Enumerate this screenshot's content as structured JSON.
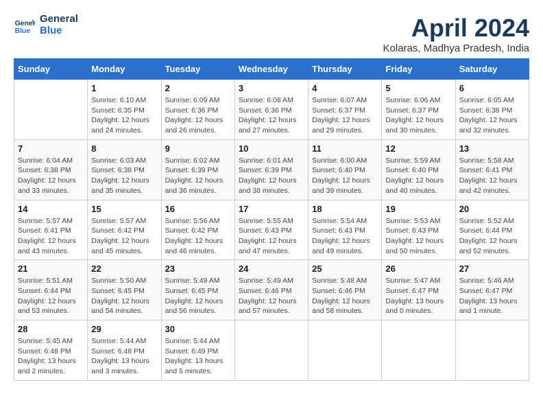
{
  "header": {
    "logo_line1": "General",
    "logo_line2": "Blue",
    "month_year": "April 2024",
    "location": "Kolaras, Madhya Pradesh, India"
  },
  "days_of_week": [
    "Sunday",
    "Monday",
    "Tuesday",
    "Wednesday",
    "Thursday",
    "Friday",
    "Saturday"
  ],
  "weeks": [
    [
      {
        "num": "",
        "info": ""
      },
      {
        "num": "1",
        "info": "Sunrise: 6:10 AM\nSunset: 6:35 PM\nDaylight: 12 hours\nand 24 minutes."
      },
      {
        "num": "2",
        "info": "Sunrise: 6:09 AM\nSunset: 6:36 PM\nDaylight: 12 hours\nand 26 minutes."
      },
      {
        "num": "3",
        "info": "Sunrise: 6:08 AM\nSunset: 6:36 PM\nDaylight: 12 hours\nand 27 minutes."
      },
      {
        "num": "4",
        "info": "Sunrise: 6:07 AM\nSunset: 6:37 PM\nDaylight: 12 hours\nand 29 minutes."
      },
      {
        "num": "5",
        "info": "Sunrise: 6:06 AM\nSunset: 6:37 PM\nDaylight: 12 hours\nand 30 minutes."
      },
      {
        "num": "6",
        "info": "Sunrise: 6:05 AM\nSunset: 6:38 PM\nDaylight: 12 hours\nand 32 minutes."
      }
    ],
    [
      {
        "num": "7",
        "info": "Sunrise: 6:04 AM\nSunset: 6:38 PM\nDaylight: 12 hours\nand 33 minutes."
      },
      {
        "num": "8",
        "info": "Sunrise: 6:03 AM\nSunset: 6:38 PM\nDaylight: 12 hours\nand 35 minutes."
      },
      {
        "num": "9",
        "info": "Sunrise: 6:02 AM\nSunset: 6:39 PM\nDaylight: 12 hours\nand 36 minutes."
      },
      {
        "num": "10",
        "info": "Sunrise: 6:01 AM\nSunset: 6:39 PM\nDaylight: 12 hours\nand 38 minutes."
      },
      {
        "num": "11",
        "info": "Sunrise: 6:00 AM\nSunset: 6:40 PM\nDaylight: 12 hours\nand 39 minutes."
      },
      {
        "num": "12",
        "info": "Sunrise: 5:59 AM\nSunset: 6:40 PM\nDaylight: 12 hours\nand 40 minutes."
      },
      {
        "num": "13",
        "info": "Sunrise: 5:58 AM\nSunset: 6:41 PM\nDaylight: 12 hours\nand 42 minutes."
      }
    ],
    [
      {
        "num": "14",
        "info": "Sunrise: 5:57 AM\nSunset: 6:41 PM\nDaylight: 12 hours\nand 43 minutes."
      },
      {
        "num": "15",
        "info": "Sunrise: 5:57 AM\nSunset: 6:42 PM\nDaylight: 12 hours\nand 45 minutes."
      },
      {
        "num": "16",
        "info": "Sunrise: 5:56 AM\nSunset: 6:42 PM\nDaylight: 12 hours\nand 46 minutes."
      },
      {
        "num": "17",
        "info": "Sunrise: 5:55 AM\nSunset: 6:43 PM\nDaylight: 12 hours\nand 47 minutes."
      },
      {
        "num": "18",
        "info": "Sunrise: 5:54 AM\nSunset: 6:43 PM\nDaylight: 12 hours\nand 49 minutes."
      },
      {
        "num": "19",
        "info": "Sunrise: 5:53 AM\nSunset: 6:43 PM\nDaylight: 12 hours\nand 50 minutes."
      },
      {
        "num": "20",
        "info": "Sunrise: 5:52 AM\nSunset: 6:44 PM\nDaylight: 12 hours\nand 52 minutes."
      }
    ],
    [
      {
        "num": "21",
        "info": "Sunrise: 5:51 AM\nSunset: 6:44 PM\nDaylight: 12 hours\nand 53 minutes."
      },
      {
        "num": "22",
        "info": "Sunrise: 5:50 AM\nSunset: 6:45 PM\nDaylight: 12 hours\nand 54 minutes."
      },
      {
        "num": "23",
        "info": "Sunrise: 5:49 AM\nSunset: 6:45 PM\nDaylight: 12 hours\nand 56 minutes."
      },
      {
        "num": "24",
        "info": "Sunrise: 5:49 AM\nSunset: 6:46 PM\nDaylight: 12 hours\nand 57 minutes."
      },
      {
        "num": "25",
        "info": "Sunrise: 5:48 AM\nSunset: 6:46 PM\nDaylight: 12 hours\nand 58 minutes."
      },
      {
        "num": "26",
        "info": "Sunrise: 5:47 AM\nSunset: 6:47 PM\nDaylight: 13 hours\nand 0 minutes."
      },
      {
        "num": "27",
        "info": "Sunrise: 5:46 AM\nSunset: 6:47 PM\nDaylight: 13 hours\nand 1 minute."
      }
    ],
    [
      {
        "num": "28",
        "info": "Sunrise: 5:45 AM\nSunset: 6:48 PM\nDaylight: 13 hours\nand 2 minutes."
      },
      {
        "num": "29",
        "info": "Sunrise: 5:44 AM\nSunset: 6:48 PM\nDaylight: 13 hours\nand 3 minutes."
      },
      {
        "num": "30",
        "info": "Sunrise: 5:44 AM\nSunset: 6:49 PM\nDaylight: 13 hours\nand 5 minutes."
      },
      {
        "num": "",
        "info": ""
      },
      {
        "num": "",
        "info": ""
      },
      {
        "num": "",
        "info": ""
      },
      {
        "num": "",
        "info": ""
      }
    ]
  ]
}
